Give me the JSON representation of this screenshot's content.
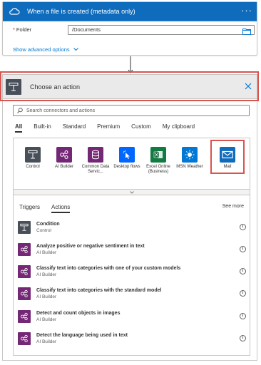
{
  "trigger": {
    "title": "When a file is created (metadata only)",
    "more": "···",
    "folder_label": "Folder",
    "folder_required": "*",
    "folder_value": "/Documents",
    "advanced_link": "Show advanced options"
  },
  "action": {
    "title": "Choose an action",
    "search_placeholder": "Search connectors and actions",
    "tabs": [
      "All",
      "Built-in",
      "Standard",
      "Premium",
      "Custom",
      "My clipboard"
    ],
    "connectors": [
      {
        "label": "Control",
        "icon": "control-icon",
        "color": "#484f58"
      },
      {
        "label": "AI Builder",
        "icon": "ai-builder-icon",
        "color": "#742774"
      },
      {
        "label": "Common Data Servic...",
        "icon": "database-icon",
        "color": "#742774"
      },
      {
        "label": "Desktop flows",
        "icon": "cursor-click-icon",
        "color": "#0066ff"
      },
      {
        "label": "Excel Online (Business)",
        "icon": "excel-icon",
        "color": "#107c41"
      },
      {
        "label": "MSN Weather",
        "icon": "weather-sun-icon",
        "color": "#0078d4"
      },
      {
        "label": "Mail",
        "icon": "mail-envelope-icon",
        "color": "#0f6cbd"
      }
    ],
    "sub_tabs": [
      "Triggers",
      "Actions"
    ],
    "see_more": "See more",
    "items": [
      {
        "name": "Condition",
        "sub": "Control",
        "icon": "control-icon",
        "color": "#484f58"
      },
      {
        "name": "Analyze positive or negative sentiment in text",
        "sub": "AI Builder",
        "icon": "ai-builder-icon",
        "color": "#742774"
      },
      {
        "name": "Classify text into categories with one of your custom models",
        "sub": "AI Builder",
        "icon": "ai-builder-icon",
        "color": "#742774"
      },
      {
        "name": "Classify text into categories with the standard model",
        "sub": "AI Builder",
        "icon": "ai-builder-icon",
        "color": "#742774"
      },
      {
        "name": "Detect and count objects in images",
        "sub": "AI Builder",
        "icon": "ai-builder-icon",
        "color": "#742774"
      },
      {
        "name": "Detect the language being used in text",
        "sub": "AI Builder",
        "icon": "ai-builder-icon",
        "color": "#742774"
      }
    ]
  }
}
